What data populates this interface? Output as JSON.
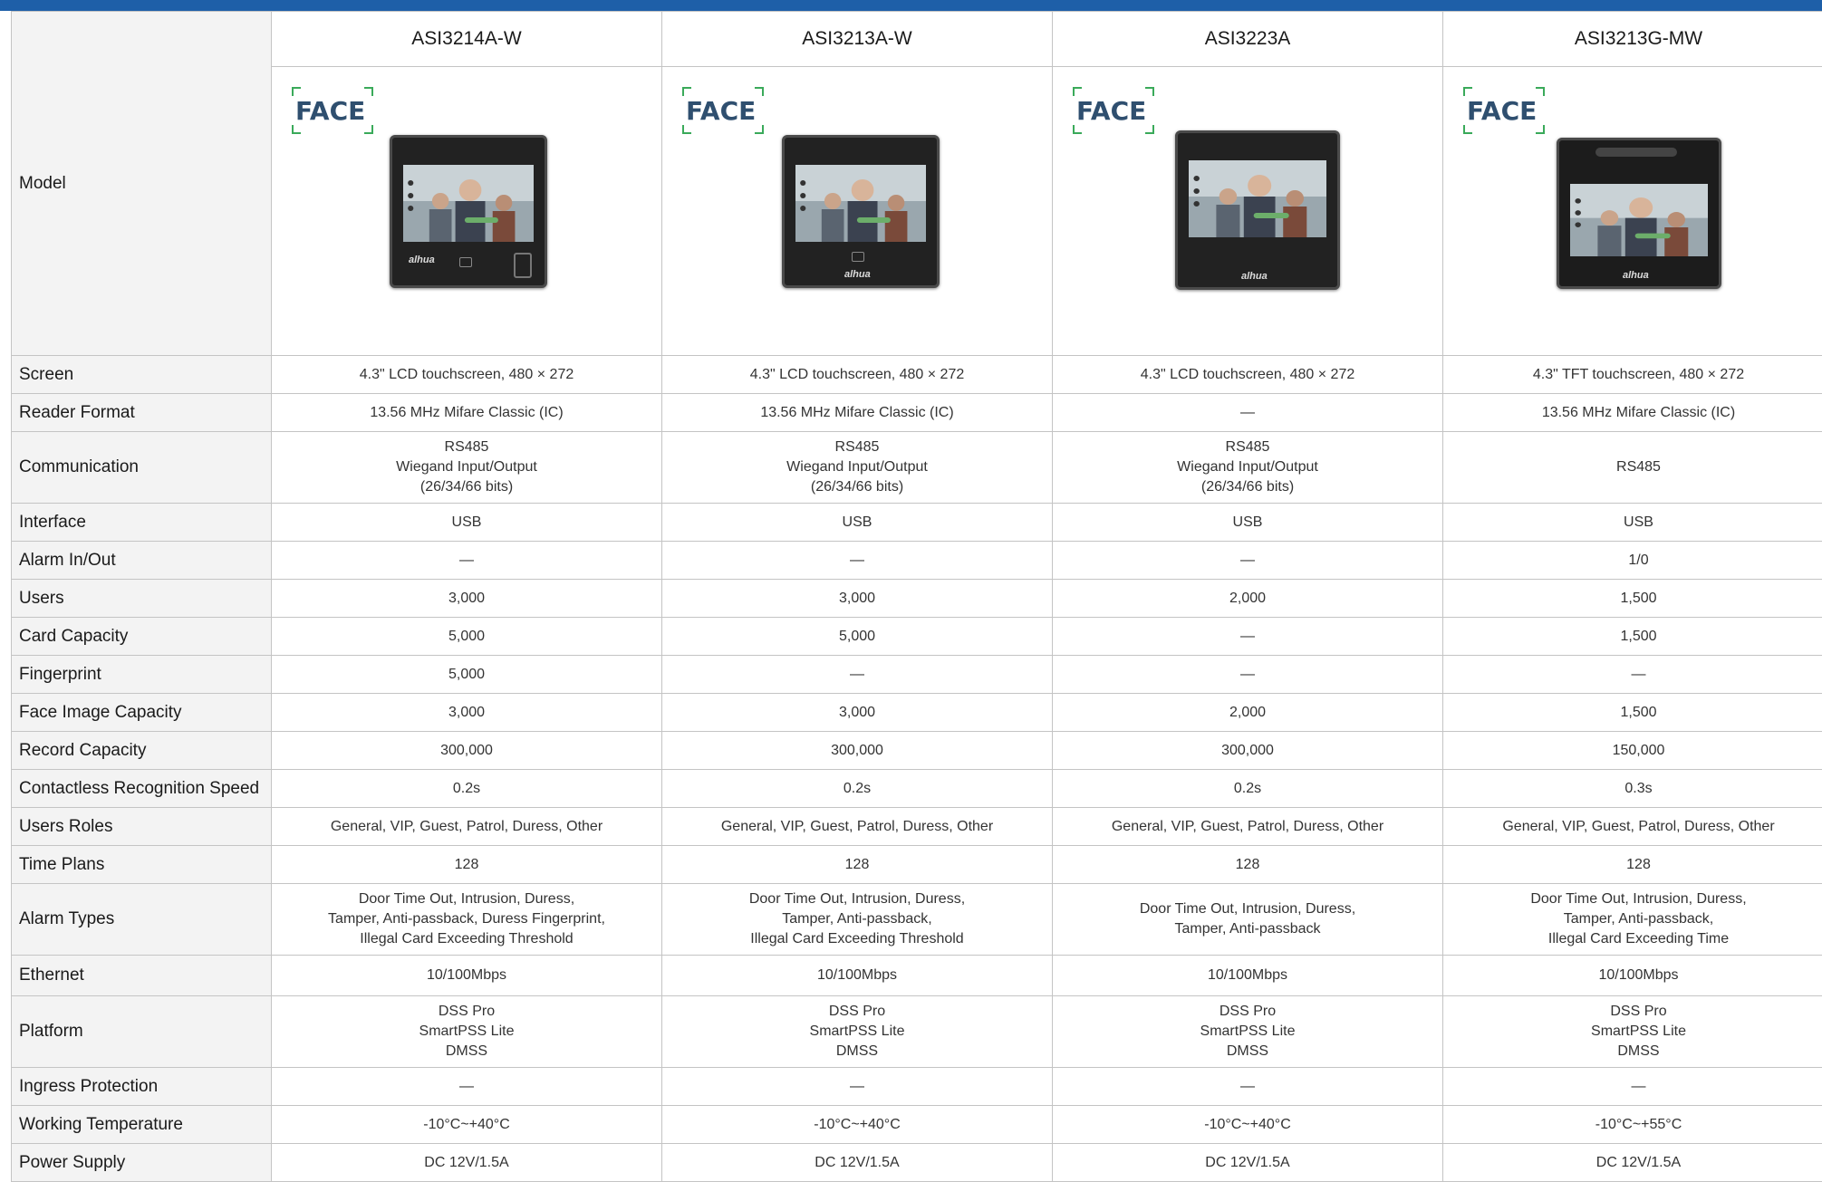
{
  "colors": {
    "accent": "#1e5fa8",
    "label_bg": "#f3f3f3",
    "border": "#c4c4c4"
  },
  "models": [
    "ASI3214A-W",
    "ASI3213A-W",
    "ASI3223A",
    "ASI3213G-MW"
  ],
  "logo": {
    "text": "FACE",
    "icon": "face-recognition-logo"
  },
  "device_brand": "alhua",
  "rows": [
    {
      "label": "Screen",
      "values": [
        [
          "4.3\" LCD touchscreen, 480 × 272"
        ],
        [
          "4.3\" LCD touchscreen, 480 × 272"
        ],
        [
          "4.3\" LCD touchscreen, 480 × 272"
        ],
        [
          "4.3\" TFT touchscreen, 480 × 272"
        ]
      ]
    },
    {
      "label": "Reader Format",
      "values": [
        [
          "13.56 MHz Mifare Classic (IC)"
        ],
        [
          "13.56 MHz Mifare Classic (IC)"
        ],
        [
          "—"
        ],
        [
          "13.56 MHz Mifare Classic (IC)"
        ]
      ]
    },
    {
      "label": "Communication",
      "values": [
        [
          "RS485",
          "Wiegand Input/Output",
          "(26/34/66 bits)"
        ],
        [
          "RS485",
          "Wiegand Input/Output",
          "(26/34/66 bits)"
        ],
        [
          "RS485",
          "Wiegand Input/Output",
          "(26/34/66 bits)"
        ],
        [
          "RS485"
        ]
      ]
    },
    {
      "label": "Interface",
      "values": [
        [
          "USB"
        ],
        [
          "USB"
        ],
        [
          "USB"
        ],
        [
          "USB"
        ]
      ]
    },
    {
      "label": "Alarm In/Out",
      "values": [
        [
          "—"
        ],
        [
          "—"
        ],
        [
          "—"
        ],
        [
          "1/0"
        ]
      ]
    },
    {
      "label": "Users",
      "values": [
        [
          "3,000"
        ],
        [
          "3,000"
        ],
        [
          "2,000"
        ],
        [
          "1,500"
        ]
      ]
    },
    {
      "label": "Card Capacity",
      "values": [
        [
          "5,000"
        ],
        [
          "5,000"
        ],
        [
          "—"
        ],
        [
          "1,500"
        ]
      ]
    },
    {
      "label": "Fingerprint",
      "values": [
        [
          "5,000"
        ],
        [
          "—"
        ],
        [
          "—"
        ],
        [
          "—"
        ]
      ]
    },
    {
      "label": "Face Image Capacity",
      "values": [
        [
          "3,000"
        ],
        [
          "3,000"
        ],
        [
          "2,000"
        ],
        [
          "1,500"
        ]
      ]
    },
    {
      "label": "Record Capacity",
      "values": [
        [
          "300,000"
        ],
        [
          "300,000"
        ],
        [
          "300,000"
        ],
        [
          "150,000"
        ]
      ]
    },
    {
      "label": "Contactless Recognition Speed",
      "values": [
        [
          "0.2s"
        ],
        [
          "0.2s"
        ],
        [
          "0.2s"
        ],
        [
          "0.3s"
        ]
      ]
    },
    {
      "label": "Users Roles",
      "values": [
        [
          "General, VIP, Guest, Patrol, Duress, Other"
        ],
        [
          "General, VIP, Guest, Patrol, Duress, Other"
        ],
        [
          "General, VIP, Guest, Patrol, Duress, Other"
        ],
        [
          "General, VIP, Guest, Patrol, Duress, Other"
        ]
      ]
    },
    {
      "label": "Time Plans",
      "values": [
        [
          "128"
        ],
        [
          "128"
        ],
        [
          "128"
        ],
        [
          "128"
        ]
      ]
    },
    {
      "label": "Alarm Types",
      "values": [
        [
          "Door Time Out, Intrusion, Duress,",
          "Tamper, Anti-passback, Duress Fingerprint,",
          "Illegal Card Exceeding Threshold"
        ],
        [
          "Door Time Out, Intrusion, Duress,",
          "Tamper, Anti-passback,",
          "Illegal Card Exceeding Threshold"
        ],
        [
          "Door Time Out, Intrusion, Duress,",
          "Tamper, Anti-passback"
        ],
        [
          "Door Time Out, Intrusion, Duress,",
          "Tamper, Anti-passback,",
          "Illegal Card Exceeding Time"
        ]
      ]
    },
    {
      "label": "Ethernet",
      "values": [
        [
          "10/100Mbps"
        ],
        [
          "10/100Mbps"
        ],
        [
          "10/100Mbps"
        ],
        [
          "10/100Mbps"
        ]
      ]
    },
    {
      "label": "Platform",
      "values": [
        [
          "DSS Pro",
          "SmartPSS Lite",
          "DMSS"
        ],
        [
          "DSS Pro",
          "SmartPSS Lite",
          "DMSS"
        ],
        [
          "DSS Pro",
          "SmartPSS Lite",
          "DMSS"
        ],
        [
          "DSS Pro",
          "SmartPSS Lite",
          "DMSS"
        ]
      ]
    },
    {
      "label": "Ingress Protection",
      "values": [
        [
          "—"
        ],
        [
          "—"
        ],
        [
          "—"
        ],
        [
          "—"
        ]
      ]
    },
    {
      "label": "Working Temperature",
      "values": [
        [
          "-10°C~+40°C"
        ],
        [
          "-10°C~+40°C"
        ],
        [
          "-10°C~+40°C"
        ],
        [
          "-10°C~+55°C"
        ]
      ]
    },
    {
      "label": "Power Supply",
      "values": [
        [
          "DC 12V/1.5A"
        ],
        [
          "DC 12V/1.5A"
        ],
        [
          "DC 12V/1.5A"
        ],
        [
          "DC 12V/1.5A"
        ]
      ]
    }
  ]
}
